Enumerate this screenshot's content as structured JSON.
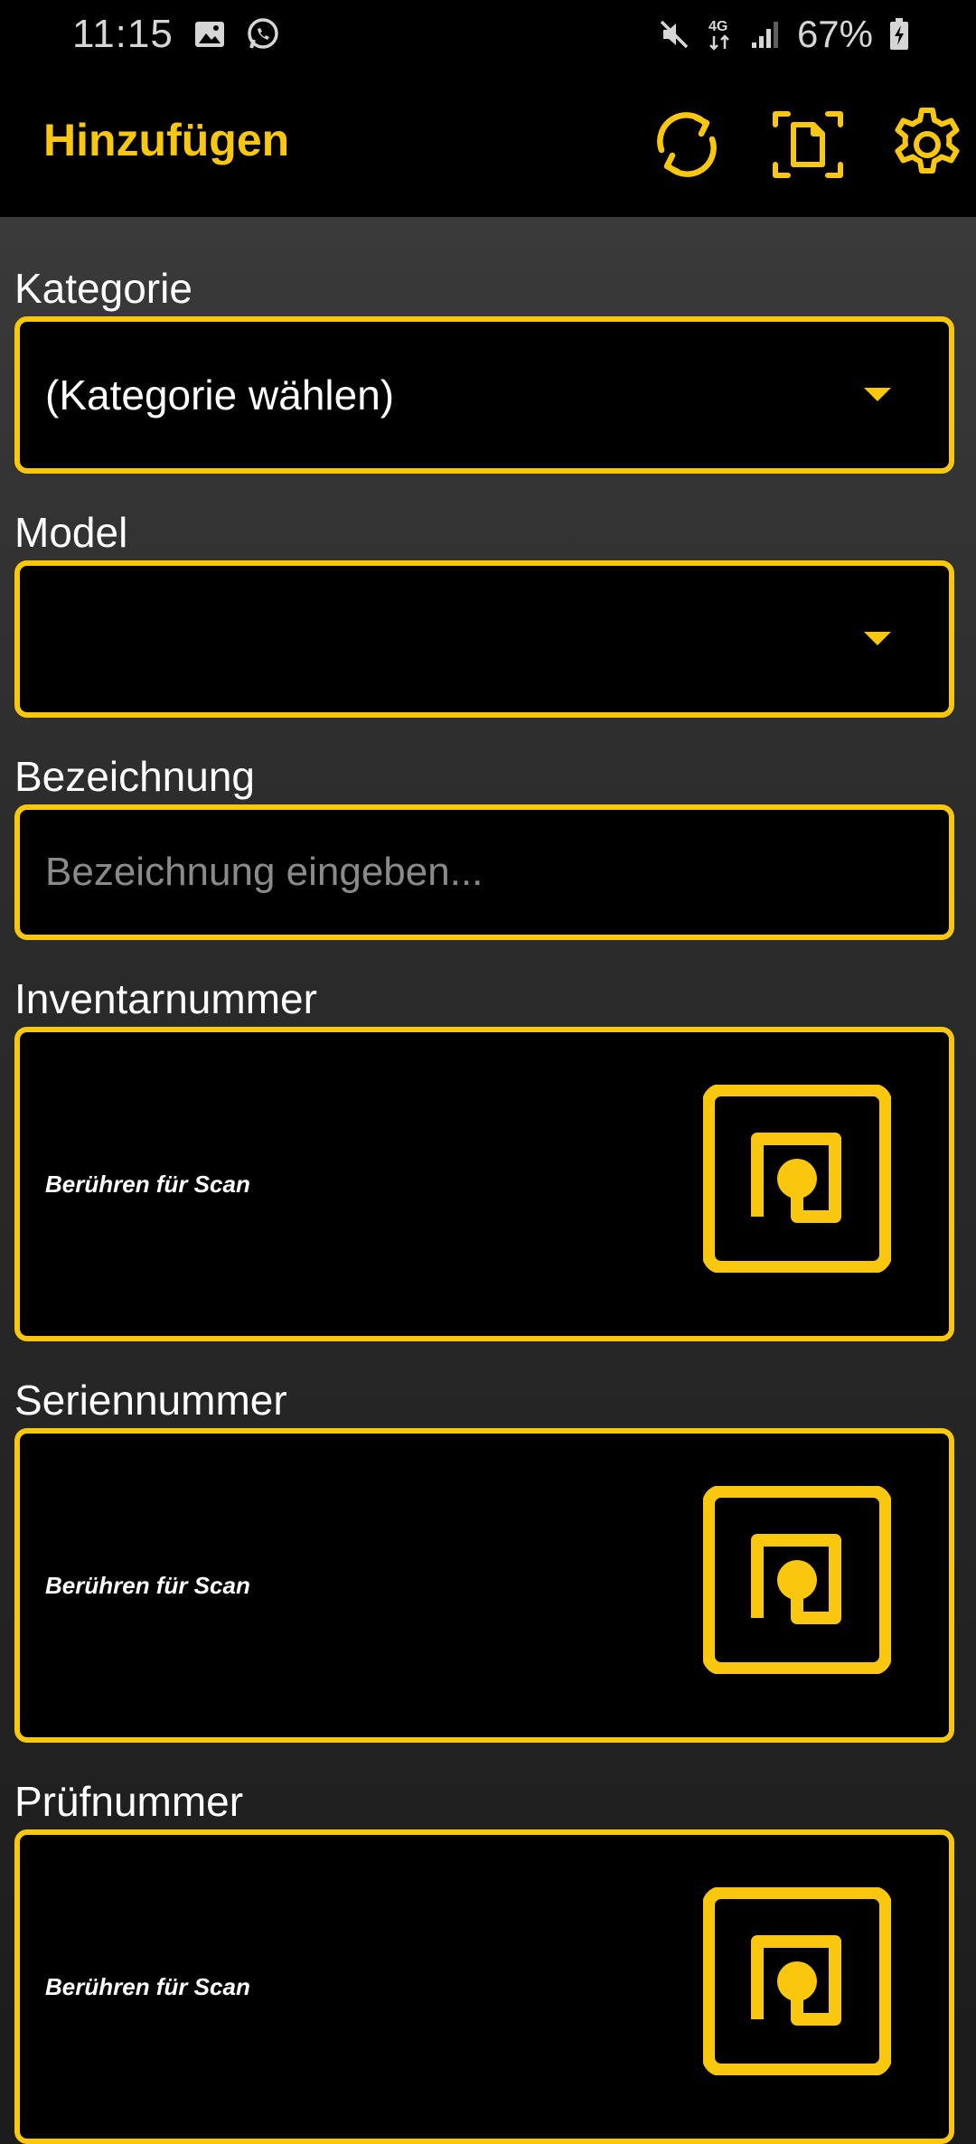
{
  "status_bar": {
    "time": "11:15",
    "battery_percent": "67%",
    "network": "4G",
    "left_icons": [
      "image-icon",
      "whatsapp-icon"
    ],
    "right_icons": [
      "mute-icon",
      "network-4g-icon",
      "signal-icon",
      "battery-icon"
    ]
  },
  "app_bar": {
    "title": "Hinzufügen",
    "actions": [
      "sync-icon",
      "document-scan-icon",
      "gear-icon"
    ],
    "accent_color": "#f9c80e"
  },
  "form": {
    "kategorie": {
      "label": "Kategorie",
      "value": "(Kategorie wählen)"
    },
    "model": {
      "label": "Model",
      "value": ""
    },
    "bezeichnung": {
      "label": "Bezeichnung",
      "placeholder": "Bezeichnung eingeben..."
    },
    "inventarnummer": {
      "label": "Inventarnummer",
      "scan_hint": "Berühren für Scan",
      "icon": "nfc-icon"
    },
    "seriennummer": {
      "label": "Seriennummer",
      "scan_hint": "Berühren für Scan",
      "icon": "nfc-icon"
    },
    "pruefnummer": {
      "label": "Prüfnummer",
      "scan_hint": "Berühren für Scan",
      "icon": "nfc-icon"
    }
  }
}
